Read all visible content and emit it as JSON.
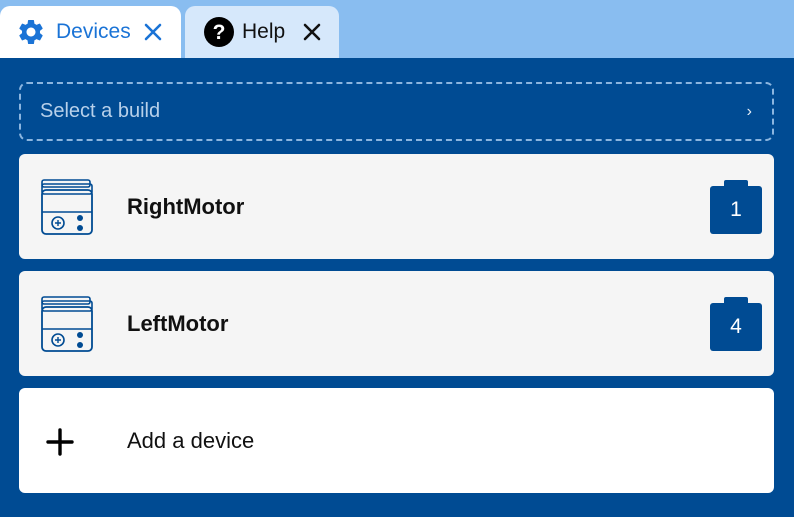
{
  "tabs": [
    {
      "label": "Devices",
      "icon": "gear-icon",
      "active": true
    },
    {
      "label": "Help",
      "icon": "help-icon",
      "active": false
    }
  ],
  "build_select": {
    "placeholder": "Select a build",
    "chevron": "›"
  },
  "devices": [
    {
      "name": "RightMotor",
      "port": "1",
      "icon": "motor-icon"
    },
    {
      "name": "LeftMotor",
      "port": "4",
      "icon": "motor-icon"
    }
  ],
  "add_device": {
    "label": "Add a device",
    "icon": "plus-icon"
  },
  "colors": {
    "tabbar": "#89bdf0",
    "panel": "#004b93",
    "accent": "#1a73d6",
    "card": "#f5f5f5"
  }
}
